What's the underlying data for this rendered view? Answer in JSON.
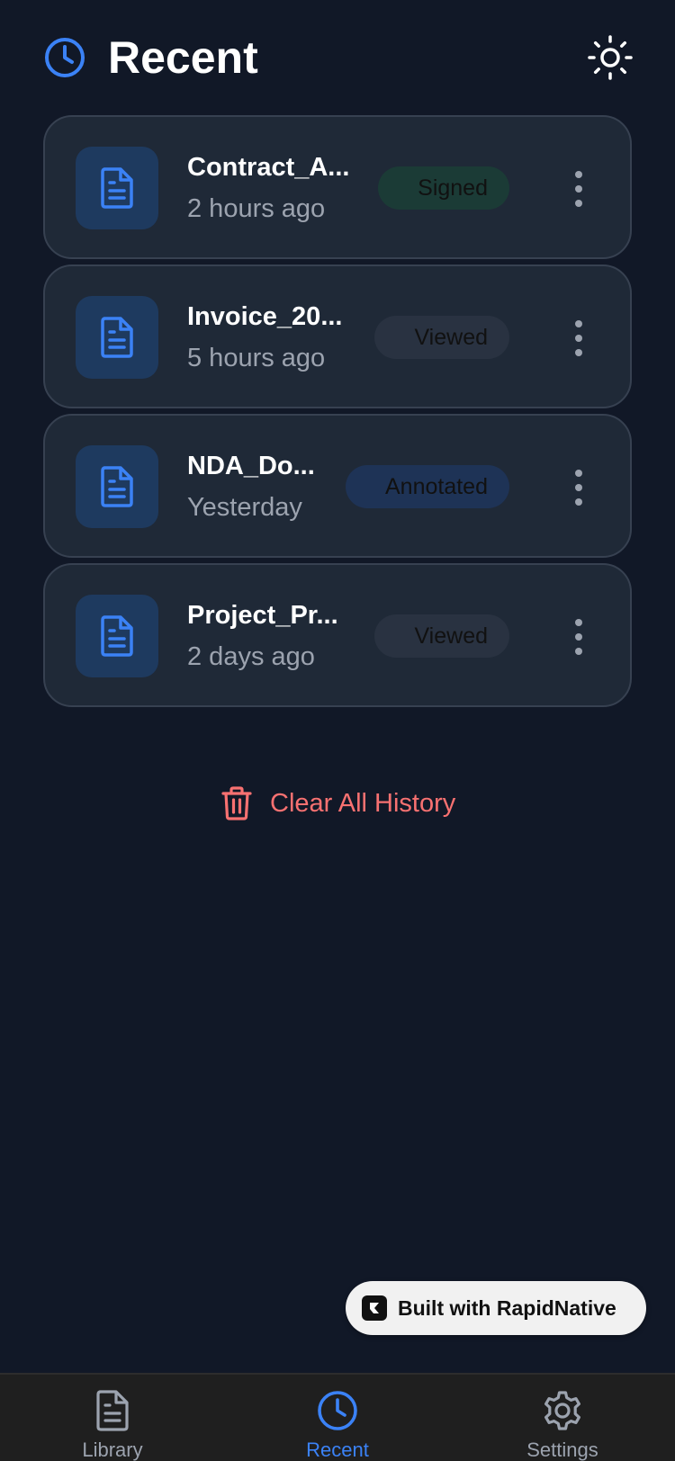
{
  "header": {
    "title": "Recent"
  },
  "documents": [
    {
      "name": "Contract_A...",
      "time": "2 hours ago",
      "status": "Signed",
      "status_bg": "#1b3b36"
    },
    {
      "name": "Invoice_20...",
      "time": "5 hours ago",
      "status": "Viewed",
      "status_bg": "#293241"
    },
    {
      "name": "NDA_Do...",
      "time": "Yesterday",
      "status": "Annotated",
      "status_bg": "#1e3356"
    },
    {
      "name": "Project_Pr...",
      "time": "2 days ago",
      "status": "Viewed",
      "status_bg": "#293241"
    }
  ],
  "actions": {
    "clear_history": "Clear All History"
  },
  "built_with": {
    "label": "Built with RapidNative"
  },
  "nav": {
    "library": "Library",
    "recent": "Recent",
    "settings": "Settings"
  },
  "colors": {
    "accent": "#3b82f6",
    "danger": "#f87171",
    "background": "#111827",
    "card": "#1f2937"
  }
}
